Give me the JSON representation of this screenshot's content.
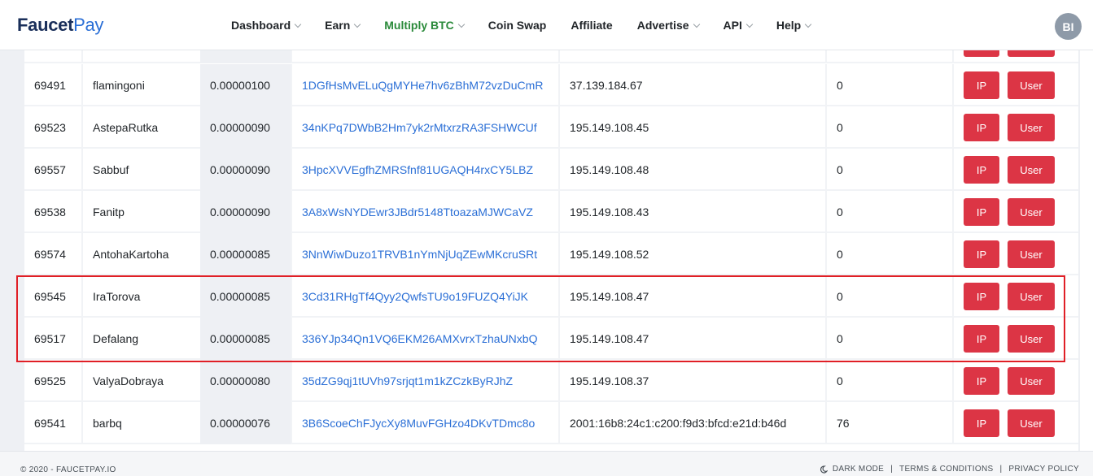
{
  "logo": {
    "part1": "Faucet",
    "part2": "Pay"
  },
  "nav": [
    {
      "label": "Dashboard",
      "dropdown": true,
      "active": false
    },
    {
      "label": "Earn",
      "dropdown": true,
      "active": false
    },
    {
      "label": "Multiply BTC",
      "dropdown": true,
      "active": true
    },
    {
      "label": "Coin Swap",
      "dropdown": false,
      "active": false
    },
    {
      "label": "Affiliate",
      "dropdown": false,
      "active": false
    },
    {
      "label": "Advertise",
      "dropdown": true,
      "active": false
    },
    {
      "label": "API",
      "dropdown": true,
      "active": false
    },
    {
      "label": "Help",
      "dropdown": true,
      "active": false
    }
  ],
  "user": {
    "initials": "BI"
  },
  "table": {
    "ip_button": "IP",
    "user_button": "User",
    "rows": [
      {
        "id": "69491",
        "username": "flamingoni",
        "amount": "0.00000100",
        "address": "1DGfHsMvELuQgMYHe7hv6zBhM72vzDuCmR",
        "ip": "37.139.184.67",
        "count": "0"
      },
      {
        "id": "69523",
        "username": "AstepaRutka",
        "amount": "0.00000090",
        "address": "34nKPq7DWbB2Hm7yk2rMtxrzRA3FSHWCUf",
        "ip": "195.149.108.45",
        "count": "0"
      },
      {
        "id": "69557",
        "username": "Sabbuf",
        "amount": "0.00000090",
        "address": "3HpcXVVEgfhZMRSfnf81UGAQH4rxCY5LBZ",
        "ip": "195.149.108.48",
        "count": "0"
      },
      {
        "id": "69538",
        "username": "Fanitp",
        "amount": "0.00000090",
        "address": "3A8xWsNYDEwr3JBdr5148TtoazaMJWCaVZ",
        "ip": "195.149.108.43",
        "count": "0"
      },
      {
        "id": "69574",
        "username": "AntohaKartoha",
        "amount": "0.00000085",
        "address": "3NnWiwDuzo1TRVB1nYmNjUqZEwMKcruSRt",
        "ip": "195.149.108.52",
        "count": "0"
      },
      {
        "id": "69545",
        "username": "IraTorova",
        "amount": "0.00000085",
        "address": "3Cd31RHgTf4Qyy2QwfsTU9o19FUZQ4YiJK",
        "ip": "195.149.108.47",
        "count": "0"
      },
      {
        "id": "69517",
        "username": "Defalang",
        "amount": "0.00000085",
        "address": "336YJp34Qn1VQ6EKM26AMXvrxTzhaUNxbQ",
        "ip": "195.149.108.47",
        "count": "0"
      },
      {
        "id": "69525",
        "username": "ValyaDobraya",
        "amount": "0.00000080",
        "address": "35dZG9qj1tUVh97srjqt1m1kZCzkByRJhZ",
        "ip": "195.149.108.37",
        "count": "0"
      },
      {
        "id": "69541",
        "username": "barbq",
        "amount": "0.00000076",
        "address": "3B6ScoeChFJycXy8MuvFGHzo4DKvTDmc8o",
        "ip": "2001:16b8:24c1:c200:f9d3:bfcd:e21d:b46d",
        "count": "76"
      }
    ]
  },
  "footer": {
    "copyright": "© 2020 - FAUCETPAY.IO",
    "dark_mode": "DARK MODE",
    "terms": "TERMS & CONDITIONS",
    "privacy": "PRIVACY POLICY"
  },
  "colors": {
    "accent_red": "#dc3545",
    "link_blue": "#2b6fd6",
    "active_green": "#2a8a3a",
    "highlight_box": "#e01f26"
  }
}
